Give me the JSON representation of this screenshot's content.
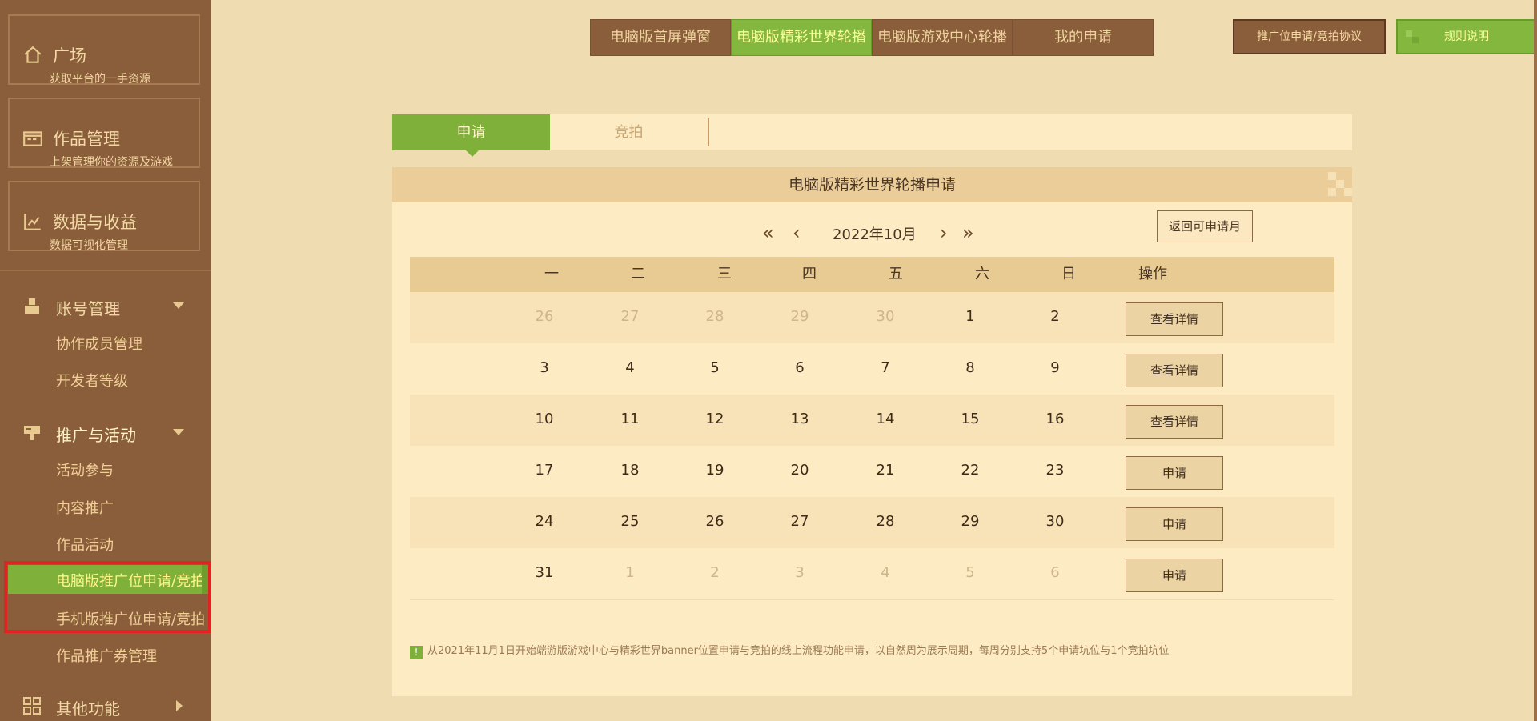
{
  "sidebar": {
    "cards": [
      {
        "title": "广场",
        "sub": "获取平台的一手资源"
      },
      {
        "title": "作品管理",
        "sub": "上架管理你的资源及游戏"
      },
      {
        "title": "数据与收益",
        "sub": "数据可视化管理"
      }
    ],
    "groups": {
      "account": {
        "label": "账号管理",
        "items": [
          "协作成员管理",
          "开发者等级"
        ]
      },
      "promo": {
        "label": "推广与活动",
        "items": [
          "活动参与",
          "内容推广",
          "作品活动",
          "电脑版推广位申请/竞拍",
          "手机版推广位申请/竞拍",
          "作品推广券管理"
        ]
      },
      "other": {
        "label": "其他功能"
      }
    }
  },
  "top_tabs": [
    "电脑版首屏弹窗",
    "电脑版精彩世界轮播",
    "电脑版游戏中心轮播",
    "我的申请"
  ],
  "buttons": {
    "agreement": "推广位申请/竞拍协议",
    "rules": "规则说明"
  },
  "sub_tabs": {
    "apply": "申请",
    "bid": "竞拍"
  },
  "panel": {
    "title": "电脑版精彩世界轮播申请",
    "nav": {
      "first": "«",
      "prev": "‹",
      "month": "2022年10月",
      "next": "›",
      "last": "»"
    },
    "back_button": "返回可申请月",
    "headers": [
      "一",
      "二",
      "三",
      "四",
      "五",
      "六",
      "日",
      "操作"
    ],
    "rows": [
      {
        "days": [
          "26",
          "27",
          "28",
          "29",
          "30",
          "1",
          "2"
        ],
        "muted": [
          0,
          1,
          2,
          3,
          4
        ],
        "action": "查看详情"
      },
      {
        "days": [
          "3",
          "4",
          "5",
          "6",
          "7",
          "8",
          "9"
        ],
        "muted": [],
        "action": "查看详情"
      },
      {
        "days": [
          "10",
          "11",
          "12",
          "13",
          "14",
          "15",
          "16"
        ],
        "muted": [],
        "action": "查看详情"
      },
      {
        "days": [
          "17",
          "18",
          "19",
          "20",
          "21",
          "22",
          "23"
        ],
        "muted": [],
        "action": "申请"
      },
      {
        "days": [
          "24",
          "25",
          "26",
          "27",
          "28",
          "29",
          "30"
        ],
        "muted": [],
        "action": "申请"
      },
      {
        "days": [
          "31",
          "1",
          "2",
          "3",
          "4",
          "5",
          "6"
        ],
        "muted": [
          1,
          2,
          3,
          4,
          5,
          6
        ],
        "action": "申请"
      }
    ],
    "note_icon": "!",
    "note": "从2021年11月1日开始端游版游戏中心与精彩世界banner位置申请与竞拍的线上流程功能申请，以自然周为展示周期，每周分别支持5个申请坑位与1个竞拍坑位"
  },
  "colors": {
    "sidebar_bg": "#8b5e3b",
    "accent_green": "#7fb03a",
    "page_bg": "#efdcb0",
    "highlight_red": "#e02424"
  }
}
